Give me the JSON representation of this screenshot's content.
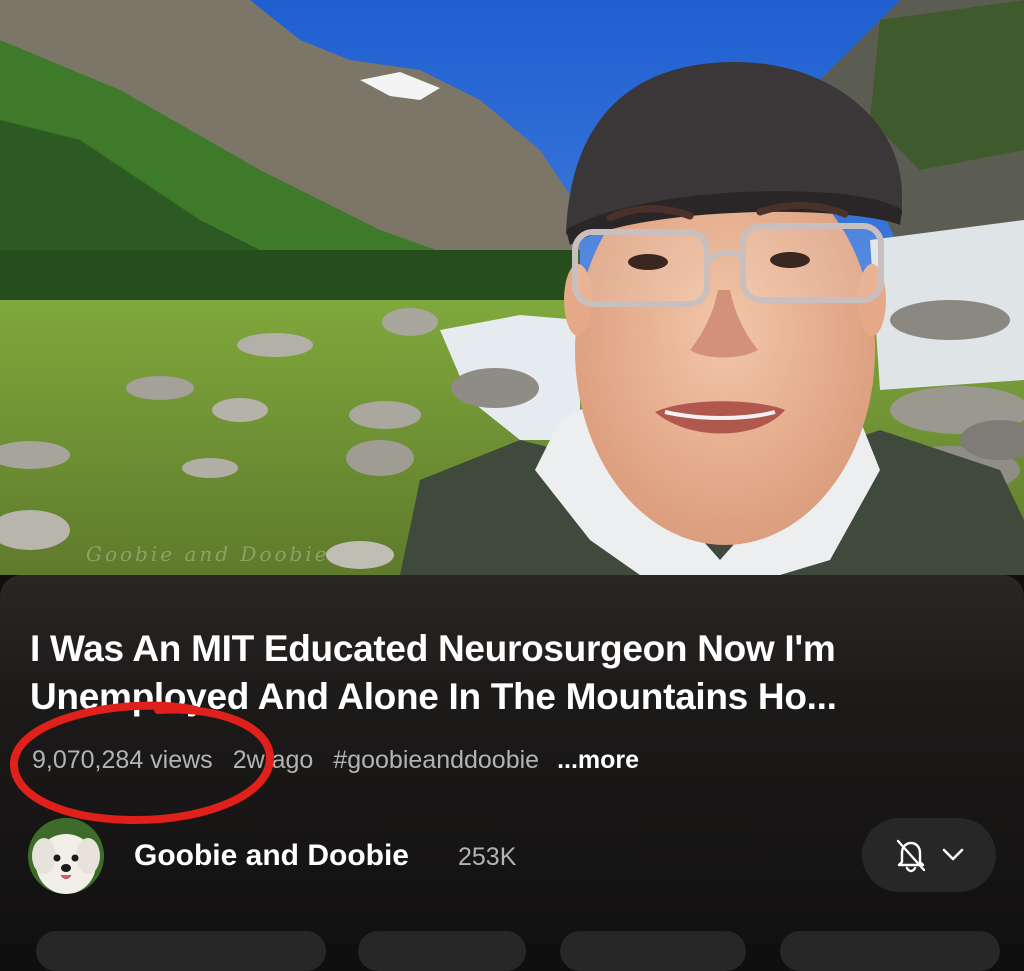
{
  "video": {
    "watermark": "Goobie and Doobie"
  },
  "info": {
    "title_line1": "I Was An MIT Educated Neurosurgeon Now I'm",
    "title_line2": "Unemployed And Alone In The Mountains Ho...",
    "views": "9,070,284 views",
    "age": "2w ago",
    "hashtag": "#goobieanddoobie",
    "more_label": "...more"
  },
  "channel": {
    "name": "Goobie and Doobie",
    "subscribers": "253K",
    "notification_icon": "bell-off-icon",
    "dropdown_icon": "chevron-down-icon"
  },
  "colors": {
    "panel_bg": "#1c1a19",
    "accent_annotation": "#e0201a",
    "button_bg": "#272727",
    "secondary_text": "#b3b3b3"
  }
}
